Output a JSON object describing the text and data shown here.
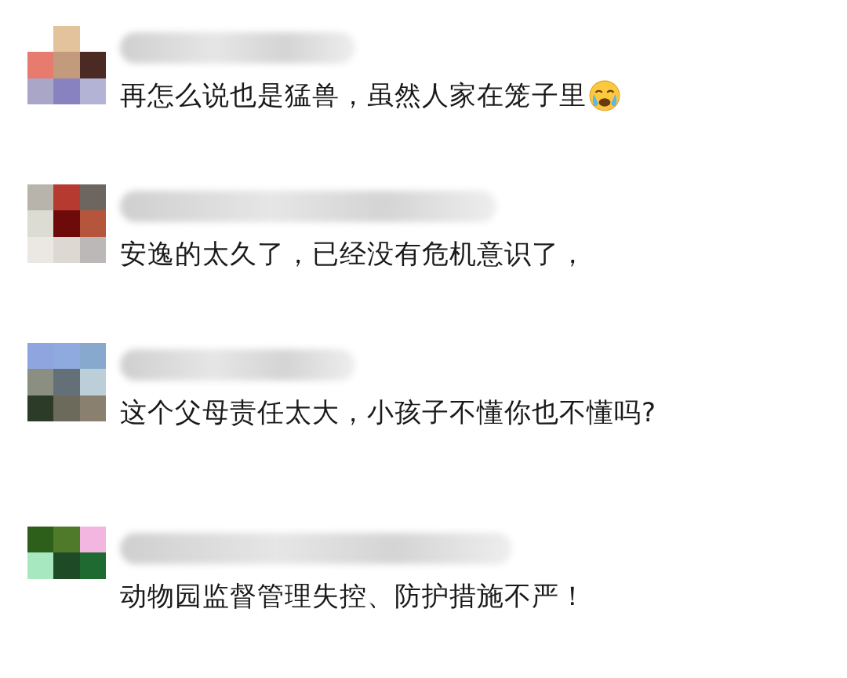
{
  "comments": [
    {
      "text": "再怎么说也是猛兽，虽然人家在笼子里",
      "emoji": true
    },
    {
      "text": "安逸的太久了，已经没有危机意识了，",
      "emoji": false
    },
    {
      "text": "这个父母责任太大，小孩子不懂你也不懂吗?",
      "emoji": false
    },
    {
      "text": "动物园监督管理失控、防护措施不严！",
      "emoji": false
    }
  ]
}
